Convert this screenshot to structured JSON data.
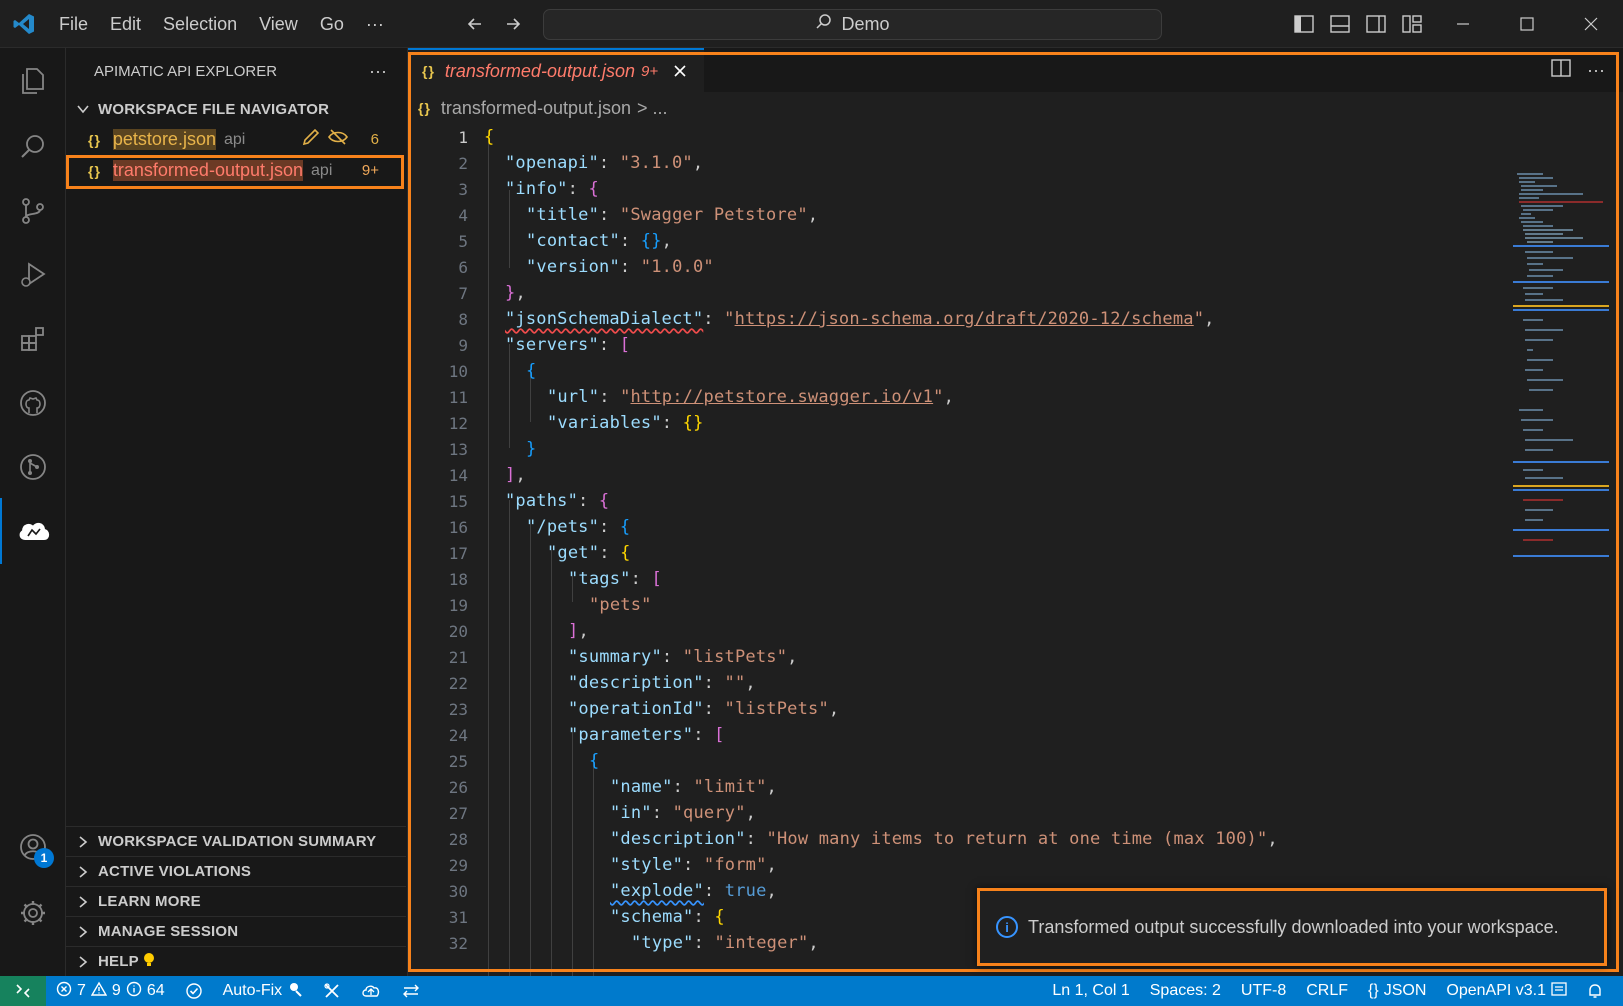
{
  "titlebar": {
    "menu": [
      "File",
      "Edit",
      "Selection",
      "View",
      "Go",
      "···"
    ],
    "search_text": "Demo"
  },
  "activity_bar": {
    "icons": [
      "explorer-icon",
      "search-icon",
      "source-control-icon",
      "run-debug-icon",
      "extensions-icon",
      "github-icon",
      "git-graph-icon",
      "apimatic-cloud-icon"
    ],
    "account_badge": "1"
  },
  "sidebar": {
    "title": "APIMATIC API EXPLORER",
    "more": "···",
    "navigator_title": "WORKSPACE FILE NAVIGATOR",
    "files": [
      {
        "name": "petstore.json",
        "desc": "api",
        "badge": "6"
      },
      {
        "name": "transformed-output.json",
        "desc": "api",
        "badge": "9+"
      }
    ],
    "bottom_sections": [
      "WORKSPACE VALIDATION SUMMARY",
      "ACTIVE VIOLATIONS",
      "LEARN MORE",
      "MANAGE SESSION",
      "HELP"
    ]
  },
  "editor": {
    "tab": {
      "name": "transformed-output.json",
      "count": "9+"
    },
    "breadcrumb": {
      "file": "transformed-output.json",
      "rest": "> ..."
    },
    "lines": [
      {
        "n": "1",
        "t": "{"
      },
      {
        "n": "2",
        "t": "\"openapi\": \"3.1.0\","
      },
      {
        "n": "3",
        "t": "\"info\": {"
      },
      {
        "n": "4",
        "t": "\"title\": \"Swagger Petstore\","
      },
      {
        "n": "5",
        "t": "\"contact\": {},"
      },
      {
        "n": "6",
        "t": "\"version\": \"1.0.0\""
      },
      {
        "n": "7",
        "t": "},"
      },
      {
        "n": "8",
        "t": "\"jsonSchemaDialect\": \"https://json-schema.org/draft/2020-12/schema\","
      },
      {
        "n": "9",
        "t": "\"servers\": ["
      },
      {
        "n": "10",
        "t": "{"
      },
      {
        "n": "11",
        "t": "\"url\": \"http://petstore.swagger.io/v1\","
      },
      {
        "n": "12",
        "t": "\"variables\": {}"
      },
      {
        "n": "13",
        "t": "}"
      },
      {
        "n": "14",
        "t": "],"
      },
      {
        "n": "15",
        "t": "\"paths\": {"
      },
      {
        "n": "16",
        "t": "\"/pets\": {"
      },
      {
        "n": "17",
        "t": "\"get\": {"
      },
      {
        "n": "18",
        "t": "\"tags\": ["
      },
      {
        "n": "19",
        "t": "\"pets\""
      },
      {
        "n": "20",
        "t": "],"
      },
      {
        "n": "21",
        "t": "\"summary\": \"listPets\","
      },
      {
        "n": "22",
        "t": "\"description\": \"\","
      },
      {
        "n": "23",
        "t": "\"operationId\": \"listPets\","
      },
      {
        "n": "24",
        "t": "\"parameters\": ["
      },
      {
        "n": "25",
        "t": "{"
      },
      {
        "n": "26",
        "t": "\"name\": \"limit\","
      },
      {
        "n": "27",
        "t": "\"in\": \"query\","
      },
      {
        "n": "28",
        "t": "\"description\": \"How many items to return at one time (max 100)\","
      },
      {
        "n": "29",
        "t": "\"style\": \"form\","
      },
      {
        "n": "30",
        "t": "\"explode\": true,"
      },
      {
        "n": "31",
        "t": "\"schema\": {"
      },
      {
        "n": "32",
        "t": "\"type\": \"integer\","
      }
    ]
  },
  "notification": {
    "message": "Transformed output successfully downloaded into your workspace."
  },
  "statusbar": {
    "errors": "7",
    "warnings": "9",
    "infos": "64",
    "autofix": "Auto-Fix",
    "position": "Ln 1, Col 1",
    "spaces": "Spaces: 2",
    "encoding": "UTF-8",
    "eol": "CRLF",
    "language": "JSON",
    "openapi": "OpenAPI v3.1"
  },
  "colors": {
    "accent": "#0078d4",
    "highlight": "#f7821b",
    "statusbar": "#007acc"
  }
}
